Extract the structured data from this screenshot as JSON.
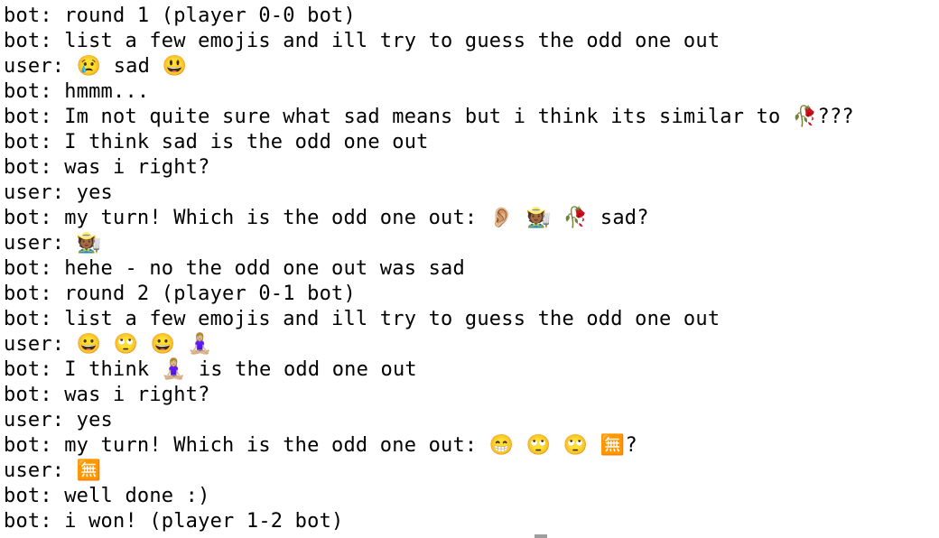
{
  "terminal": {
    "cut_off_top": "                    ",
    "lines": [
      "bot: round 1 (player 0-0 bot)",
      "bot: list a few emojis and ill try to guess the odd one out",
      "user: 😢 sad 😃",
      "bot: hmmm...",
      "bot: Im not quite sure what sad means but i think its similar to 🥀???",
      "bot: I think sad is the odd one out",
      "bot: was i right?",
      "user: yes",
      "bot: my turn! Which is the odd one out: 👂🏼 🧑🏾‍🌾 🥀 sad?",
      "user: 🧑🏾‍🌾",
      "bot: hehe - no the odd one out was sad",
      "bot: round 2 (player 0-1 bot)",
      "bot: list a few emojis and ill try to guess the odd one out",
      "user: 😀 🙄 😀 🧘🏼‍♀️",
      "bot: I think 🧘🏼‍♀️ is the odd one out",
      "bot: was i right?",
      "user: yes",
      "bot: my turn! Which is the odd one out: 😁 🙄 🙄 🈚?",
      "user: 🈚",
      "bot: well done :)",
      "bot: i won! (player 1-2 bot)"
    ]
  }
}
